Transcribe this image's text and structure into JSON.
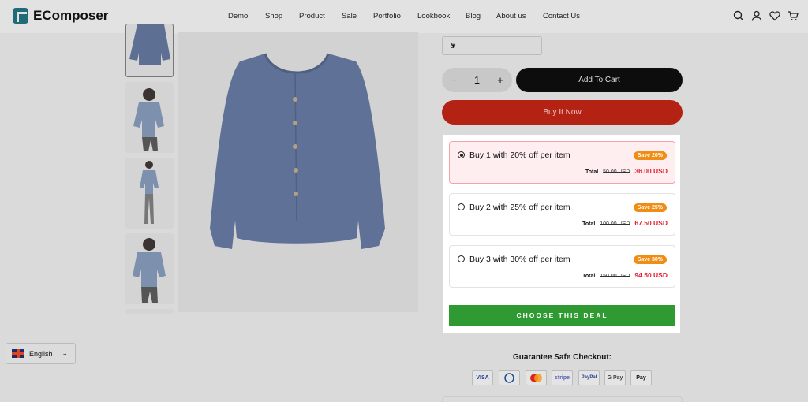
{
  "header": {
    "logo": "EComposer",
    "nav": [
      "Demo",
      "Shop",
      "Product",
      "Sale",
      "Portfolio",
      "Lookbook",
      "Blog",
      "About us",
      "Contact Us"
    ]
  },
  "product": {
    "size_value": "S",
    "quantity": "1",
    "add_to_cart": "Add To Cart",
    "buy_now": "Buy It Now"
  },
  "deals": {
    "options": [
      {
        "title": "Buy 1 with 20% off per item",
        "badge": "Save 20%",
        "total_label": "Total",
        "old": "50.00 USD",
        "new": "36.00 USD",
        "selected": true
      },
      {
        "title": "Buy 2 with 25% off per item",
        "badge": "Save 25%",
        "total_label": "Total",
        "old": "100.00 USD",
        "new": "67.50 USD",
        "selected": false
      },
      {
        "title": "Buy 3 with 30% off per item",
        "badge": "Save 30%",
        "total_label": "Total",
        "old": "150.00 USD",
        "new": "94.50 USD",
        "selected": false
      }
    ],
    "cta": "CHOOSE THIS DEAL"
  },
  "language": {
    "label": "English"
  },
  "checkout": {
    "guarantee": "Guarantee Safe Checkout:",
    "methods": [
      "VISA",
      "Diners",
      "Mastercard",
      "stripe",
      "PayPal",
      "G Pay",
      "Apple Pay"
    ]
  },
  "colors": {
    "accent_green": "#2f9a31",
    "buy_red": "#b42214",
    "price_red": "#e51c2a",
    "badge_orange": "#ef8d14"
  }
}
